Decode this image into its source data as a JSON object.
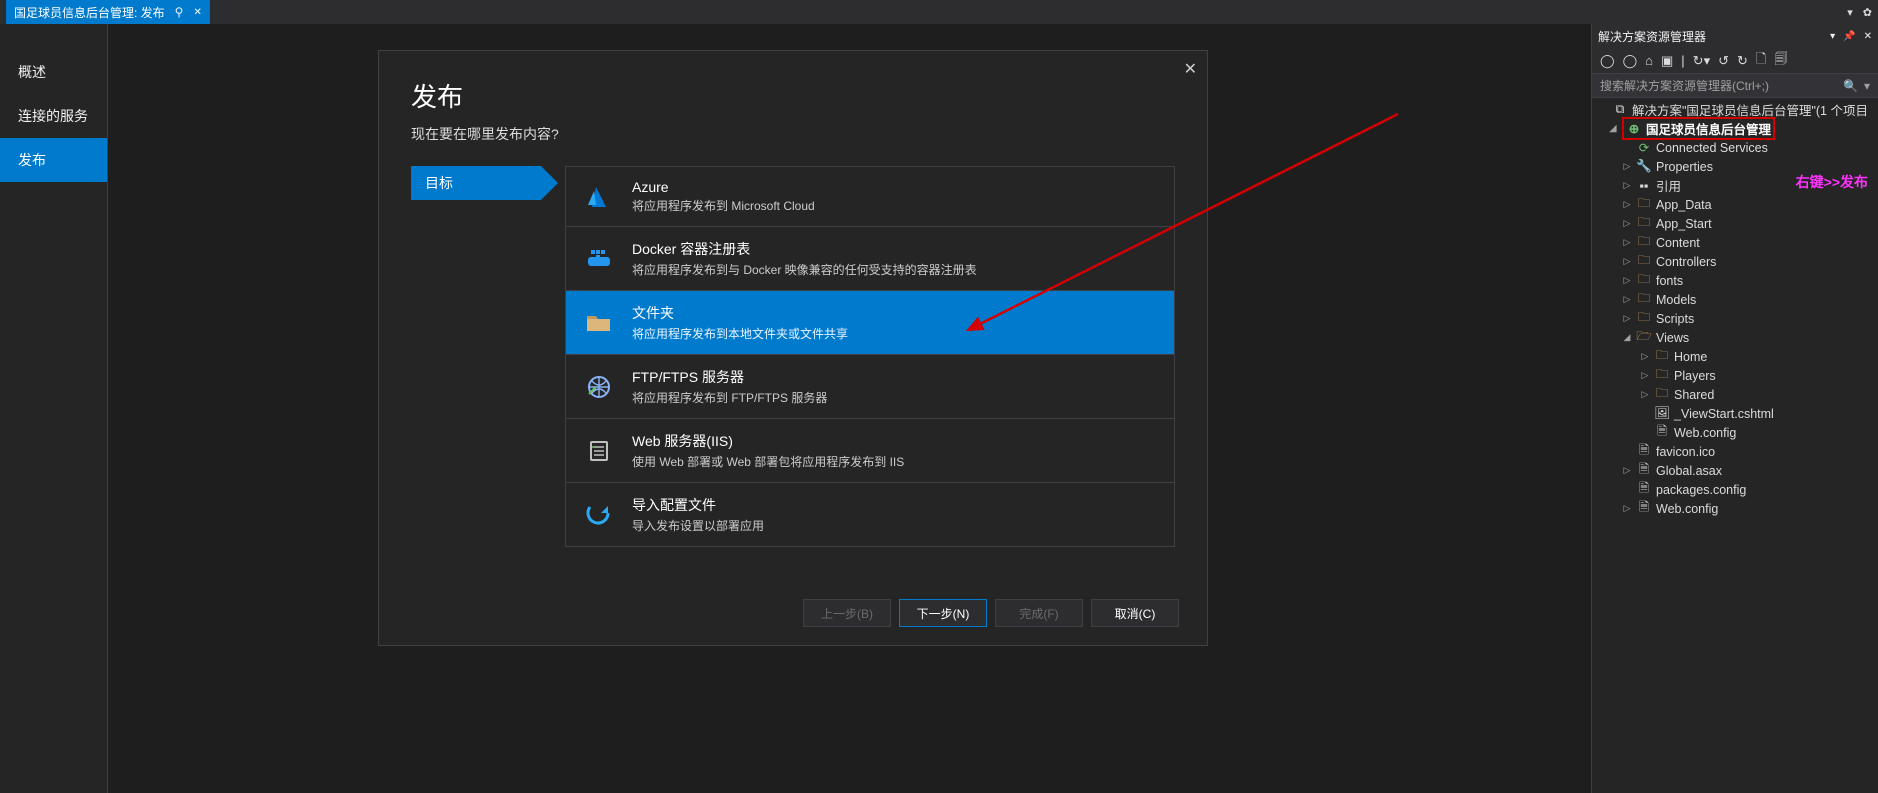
{
  "tab": {
    "title": "国足球员信息后台管理: 发布",
    "pin_glyph": "⚲",
    "close_glyph": "✕"
  },
  "left_nav": {
    "overview": "概述",
    "connected_svc": "连接的服务",
    "publish": "发布"
  },
  "dialog": {
    "title": "发布",
    "subtitle": "现在要在哪里发布内容?",
    "step_label": "目标",
    "options": [
      {
        "title": "Azure",
        "desc": "将应用程序发布到 Microsoft Cloud"
      },
      {
        "title": "Docker 容器注册表",
        "desc": "将应用程序发布到与 Docker 映像兼容的任何受支持的容器注册表"
      },
      {
        "title": "文件夹",
        "desc": "将应用程序发布到本地文件夹或文件共享"
      },
      {
        "title": "FTP/FTPS 服务器",
        "desc": "将应用程序发布到 FTP/FTPS 服务器"
      },
      {
        "title": "Web 服务器(IIS)",
        "desc": "使用 Web 部署或 Web 部署包将应用程序发布到 IIS"
      },
      {
        "title": "导入配置文件",
        "desc": "导入发布设置以部署应用"
      }
    ],
    "footer": {
      "back": "上一步(B)",
      "next": "下一步(N)",
      "finish": "完成(F)",
      "cancel": "取消(C)"
    }
  },
  "sln": {
    "panel_title": "解决方案资源管理器",
    "search_placeholder": "搜索解决方案资源管理器(Ctrl+;)",
    "solution_label": "解决方案\"国足球员信息后台管理\"(1 个项目",
    "project_label": "国足球员信息后台管理",
    "annotation": "右键>>发布",
    "nodes": {
      "connected": "Connected Services",
      "properties": "Properties",
      "references": "引用",
      "app_data": "App_Data",
      "app_start": "App_Start",
      "content": "Content",
      "controllers": "Controllers",
      "fonts": "fonts",
      "models": "Models",
      "scripts": "Scripts",
      "views": "Views",
      "home": "Home",
      "players": "Players",
      "shared": "Shared",
      "viewstart": "_ViewStart.cshtml",
      "webconfig_views": "Web.config",
      "favicon": "favicon.ico",
      "globalasax": "Global.asax",
      "packages": "packages.config",
      "webconfig_root": "Web.config"
    }
  }
}
